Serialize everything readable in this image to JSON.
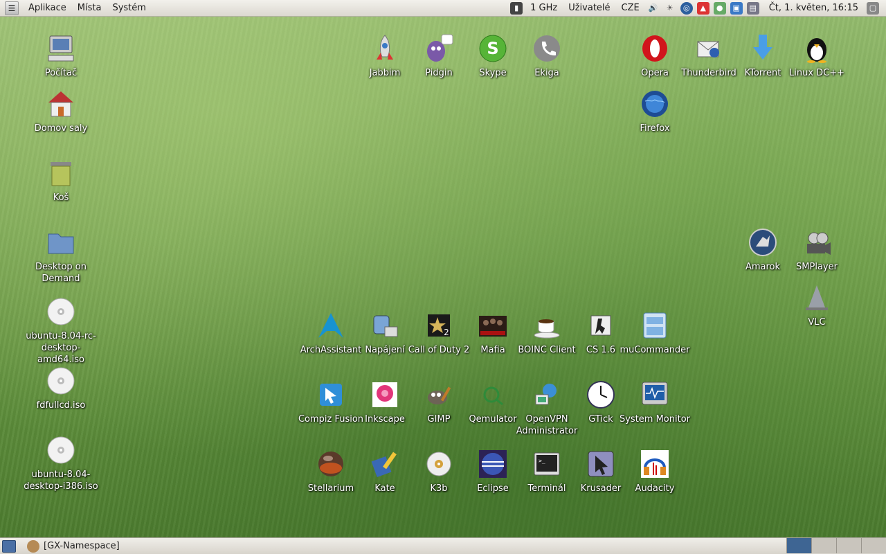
{
  "top_panel": {
    "menus": [
      "Aplikace",
      "Místa",
      "Systém"
    ],
    "cpu_freq": "1 GHz",
    "users": "Uživatelé",
    "keyboard": "CZE",
    "clock": "Čt, 1. květen, 16:15"
  },
  "desktop_left": [
    {
      "label": "Počítač",
      "icon": "computer-icon"
    },
    {
      "label": "Domov saly",
      "icon": "home-icon"
    },
    {
      "label": "Koš",
      "icon": "trash-icon"
    },
    {
      "label": "Desktop on Demand",
      "icon": "folder-icon"
    },
    {
      "label": "ubuntu-8.04-rc-desktop-amd64.iso",
      "icon": "disc-icon"
    },
    {
      "label": "fdfullcd.iso",
      "icon": "disc-icon"
    },
    {
      "label": "ubuntu-8.04-desktop-i386.iso",
      "icon": "disc-icon"
    }
  ],
  "desktop_top": [
    {
      "label": "Jabbim",
      "icon": "rocket-icon"
    },
    {
      "label": "Pidgin",
      "icon": "pidgin-icon"
    },
    {
      "label": "Skype",
      "icon": "skype-icon"
    },
    {
      "label": "Ekiga",
      "icon": "phone-icon"
    },
    {
      "label": "Opera",
      "icon": "opera-icon"
    },
    {
      "label": "Thunderbird",
      "icon": "mail-icon"
    },
    {
      "label": "KTorrent",
      "icon": "download-icon"
    },
    {
      "label": "Linux DC++",
      "icon": "tux-icon"
    },
    {
      "label": "Firefox",
      "icon": "globe-icon"
    }
  ],
  "desktop_right": [
    {
      "label": "Amarok",
      "icon": "amarok-icon"
    },
    {
      "label": "SMPlayer",
      "icon": "film-icon"
    },
    {
      "label": "VLC",
      "icon": "cone-icon"
    }
  ],
  "desktop_grid": [
    {
      "label": "ArchAssistant",
      "icon": "arch-icon"
    },
    {
      "label": "Napájení",
      "icon": "power-icon"
    },
    {
      "label": "Call of Duty 2",
      "icon": "star-icon"
    },
    {
      "label": "Mafia",
      "icon": "mafia-icon"
    },
    {
      "label": "BOINC Client",
      "icon": "coffee-icon"
    },
    {
      "label": "CS 1.6",
      "icon": "cs-icon"
    },
    {
      "label": "muCommander",
      "icon": "cabinet-icon"
    },
    {
      "label": "Compiz Fusion",
      "icon": "cursor-icon"
    },
    {
      "label": "Inkscape",
      "icon": "flower-icon"
    },
    {
      "label": "GIMP",
      "icon": "gimp-icon"
    },
    {
      "label": "Qemulator",
      "icon": "qemu-icon"
    },
    {
      "label": "OpenVPN Administrator",
      "icon": "network-icon"
    },
    {
      "label": "GTick",
      "icon": "clock-icon"
    },
    {
      "label": "System Monitor",
      "icon": "monitor-icon"
    },
    {
      "label": "Stellarium",
      "icon": "planet-icon"
    },
    {
      "label": "Kate",
      "icon": "pencil-icon"
    },
    {
      "label": "K3b",
      "icon": "cd-icon"
    },
    {
      "label": "Eclipse",
      "icon": "eclipse-icon"
    },
    {
      "label": "Terminál",
      "icon": "terminal-icon"
    },
    {
      "label": "Krusader",
      "icon": "pointer-icon"
    },
    {
      "label": "Audacity",
      "icon": "headphones-icon"
    }
  ],
  "bottom_panel": {
    "task_label": "[GX-Namespace]"
  }
}
